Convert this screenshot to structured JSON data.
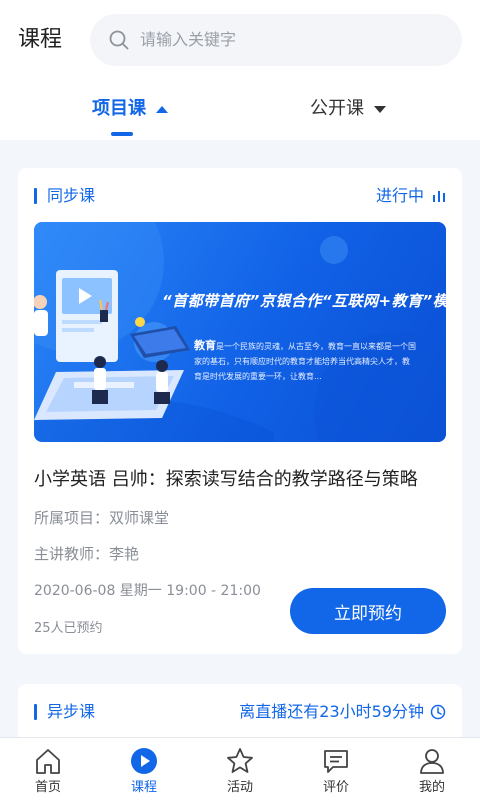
{
  "header": {
    "title": "课程",
    "search_placeholder": "请输入关键字"
  },
  "tabs": [
    {
      "label": "项目课",
      "active": true
    },
    {
      "label": "公开课",
      "active": false
    }
  ],
  "sync_section": {
    "title": "同步课",
    "status": "进行中",
    "banner": {
      "title": "“首都带首府”京银合作“互联网+教育”模式",
      "keyword": "教育",
      "text": "是一个民族的灵魂，从古至今，教育一直以来都是一个国家的基石，只有顺应时代的教育才能培养当代高精尖人才，教育是时代发展的重要一环，让教育..."
    },
    "course_title": "小学英语 吕帅：探索读写结合的教学路径与策略",
    "project": "所属项目：双师课堂",
    "teacher": "主讲教师：李艳",
    "schedule": "2020-06-08  星期一  19:00 - 21:00",
    "booked": "25人已预约",
    "book_button": "立即预约"
  },
  "async_section": {
    "title": "异步课",
    "countdown": "离直播还有23小时59分钟"
  },
  "bottom_nav": [
    {
      "label": "首页",
      "icon": "home-icon",
      "active": false
    },
    {
      "label": "课程",
      "icon": "play-icon",
      "active": true
    },
    {
      "label": "活动",
      "icon": "star-icon",
      "active": false
    },
    {
      "label": "评价",
      "icon": "comment-icon",
      "active": false
    },
    {
      "label": "我的",
      "icon": "user-icon",
      "active": false
    }
  ],
  "colors": {
    "accent": "#1167e8",
    "background": "#f3f6fb",
    "muted_text": "#8a8f97"
  }
}
